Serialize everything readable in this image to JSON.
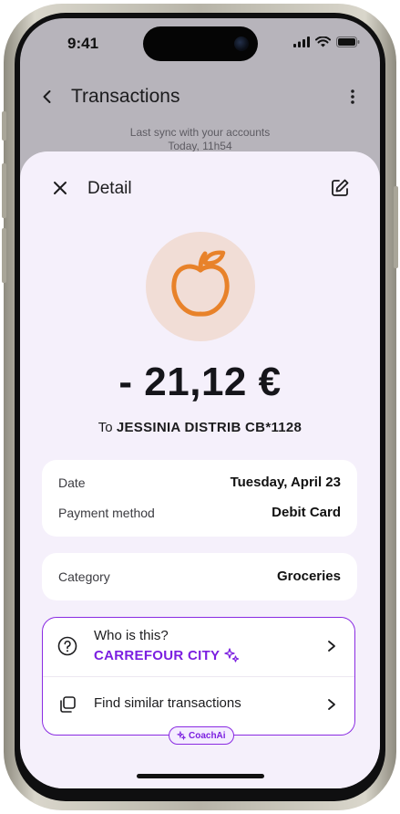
{
  "status_bar": {
    "time": "9:41"
  },
  "header": {
    "title": "Transactions"
  },
  "sync": {
    "line1": "Last sync with your accounts",
    "line2": "Today, 11h54"
  },
  "detail": {
    "title": "Detail",
    "amount": "- 21,12 €",
    "merchant_prefix": "To",
    "merchant_name": "JESSINIA DISTRIB CB*1128",
    "category_icon": "apple-icon"
  },
  "info_card": {
    "rows": [
      {
        "label": "Date",
        "value": "Tuesday, April 23"
      },
      {
        "label": "Payment method",
        "value": "Debit Card"
      }
    ]
  },
  "category_card": {
    "label": "Category",
    "value": "Groceries"
  },
  "coach": {
    "who_label": "Who is this?",
    "who_value": "CARREFOUR CITY",
    "similar_label": "Find similar transactions",
    "badge": "CoachAi"
  },
  "colors": {
    "accent": "#7b1fe0",
    "sheet_bg": "#f5f0fb",
    "icon_orange": "#e8822a"
  }
}
